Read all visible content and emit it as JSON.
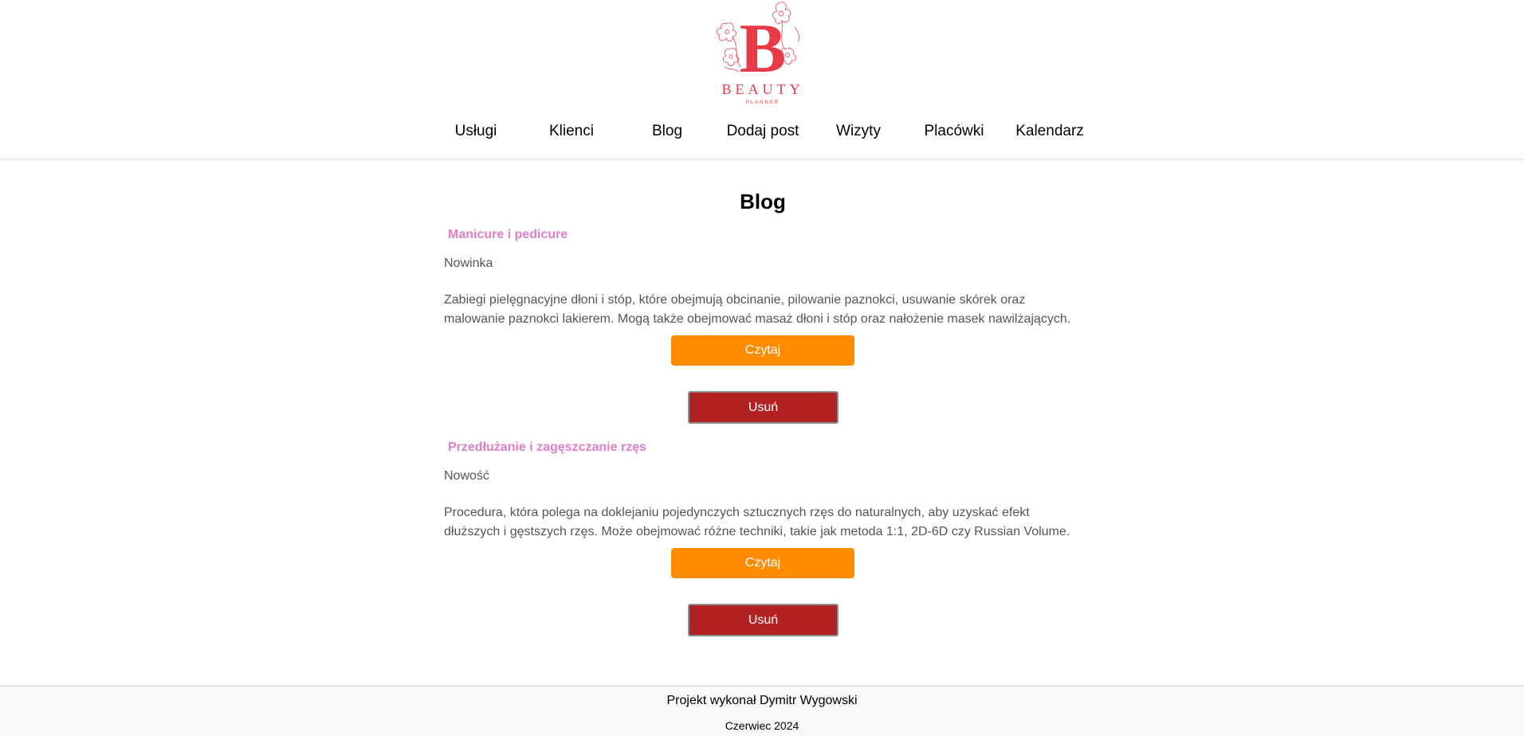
{
  "header": {
    "logo": {
      "letter": "B",
      "name": "BEAUTY",
      "tagline": "PLANNER",
      "color": "#e83a48"
    },
    "nav": [
      {
        "label": "Usługi"
      },
      {
        "label": "Klienci"
      },
      {
        "label": "Blog"
      },
      {
        "label": "Dodaj post"
      },
      {
        "label": "Wizyty"
      },
      {
        "label": "Placówki"
      },
      {
        "label": "Kalendarz"
      }
    ]
  },
  "main": {
    "title": "Blog",
    "posts": [
      {
        "title": "Manicure i pedicure",
        "tag": "Nowinka",
        "description": "Zabiegi pielęgnacyjne dłoni i stóp, które obejmują obcinanie, pilowanie paznokci, usuwanie skórek oraz malowanie paznokci lakierem. Mogą także obejmować masaż dłoni i stóp oraz nałożenie masek nawilżających.",
        "read_label": "Czytaj",
        "delete_label": "Usuń"
      },
      {
        "title": "Przedłużanie i zagęszczanie rzęs",
        "tag": "Nowość",
        "description": "Procedura, która polega na doklejaniu pojedynczych sztucznych rzęs do naturalnych, aby uzyskać efekt dłuższych i gęstszych rzęs. Może obejmować różne techniki, takie jak metoda 1:1, 2D-6D czy Russian Volume.",
        "read_label": "Czytaj",
        "delete_label": "Usuń"
      }
    ]
  },
  "footer": {
    "author": "Projekt wykonał Dymitr Wygowski",
    "date": "Czerwiec 2024"
  },
  "colors": {
    "accent_title": "#e07ec6",
    "read_button": "#ff8c00",
    "delete_button": "#b22222",
    "logo": "#e83a48"
  }
}
